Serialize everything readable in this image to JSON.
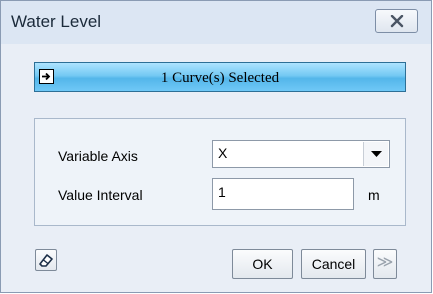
{
  "window": {
    "title": "Water Level",
    "close_icon": "close-icon"
  },
  "selection_bar": {
    "label": "1 Curve(s) Selected",
    "icon": "arrow-in-box-icon",
    "accent": "#5fbeee"
  },
  "form": {
    "variable_axis": {
      "label": "Variable Axis",
      "value": "X"
    },
    "value_interval": {
      "label": "Value Interval",
      "value": "1",
      "unit": "m"
    }
  },
  "footer": {
    "eraser_icon": "eraser-icon",
    "ok_label": "OK",
    "cancel_label": "Cancel",
    "more_label": "≫"
  }
}
